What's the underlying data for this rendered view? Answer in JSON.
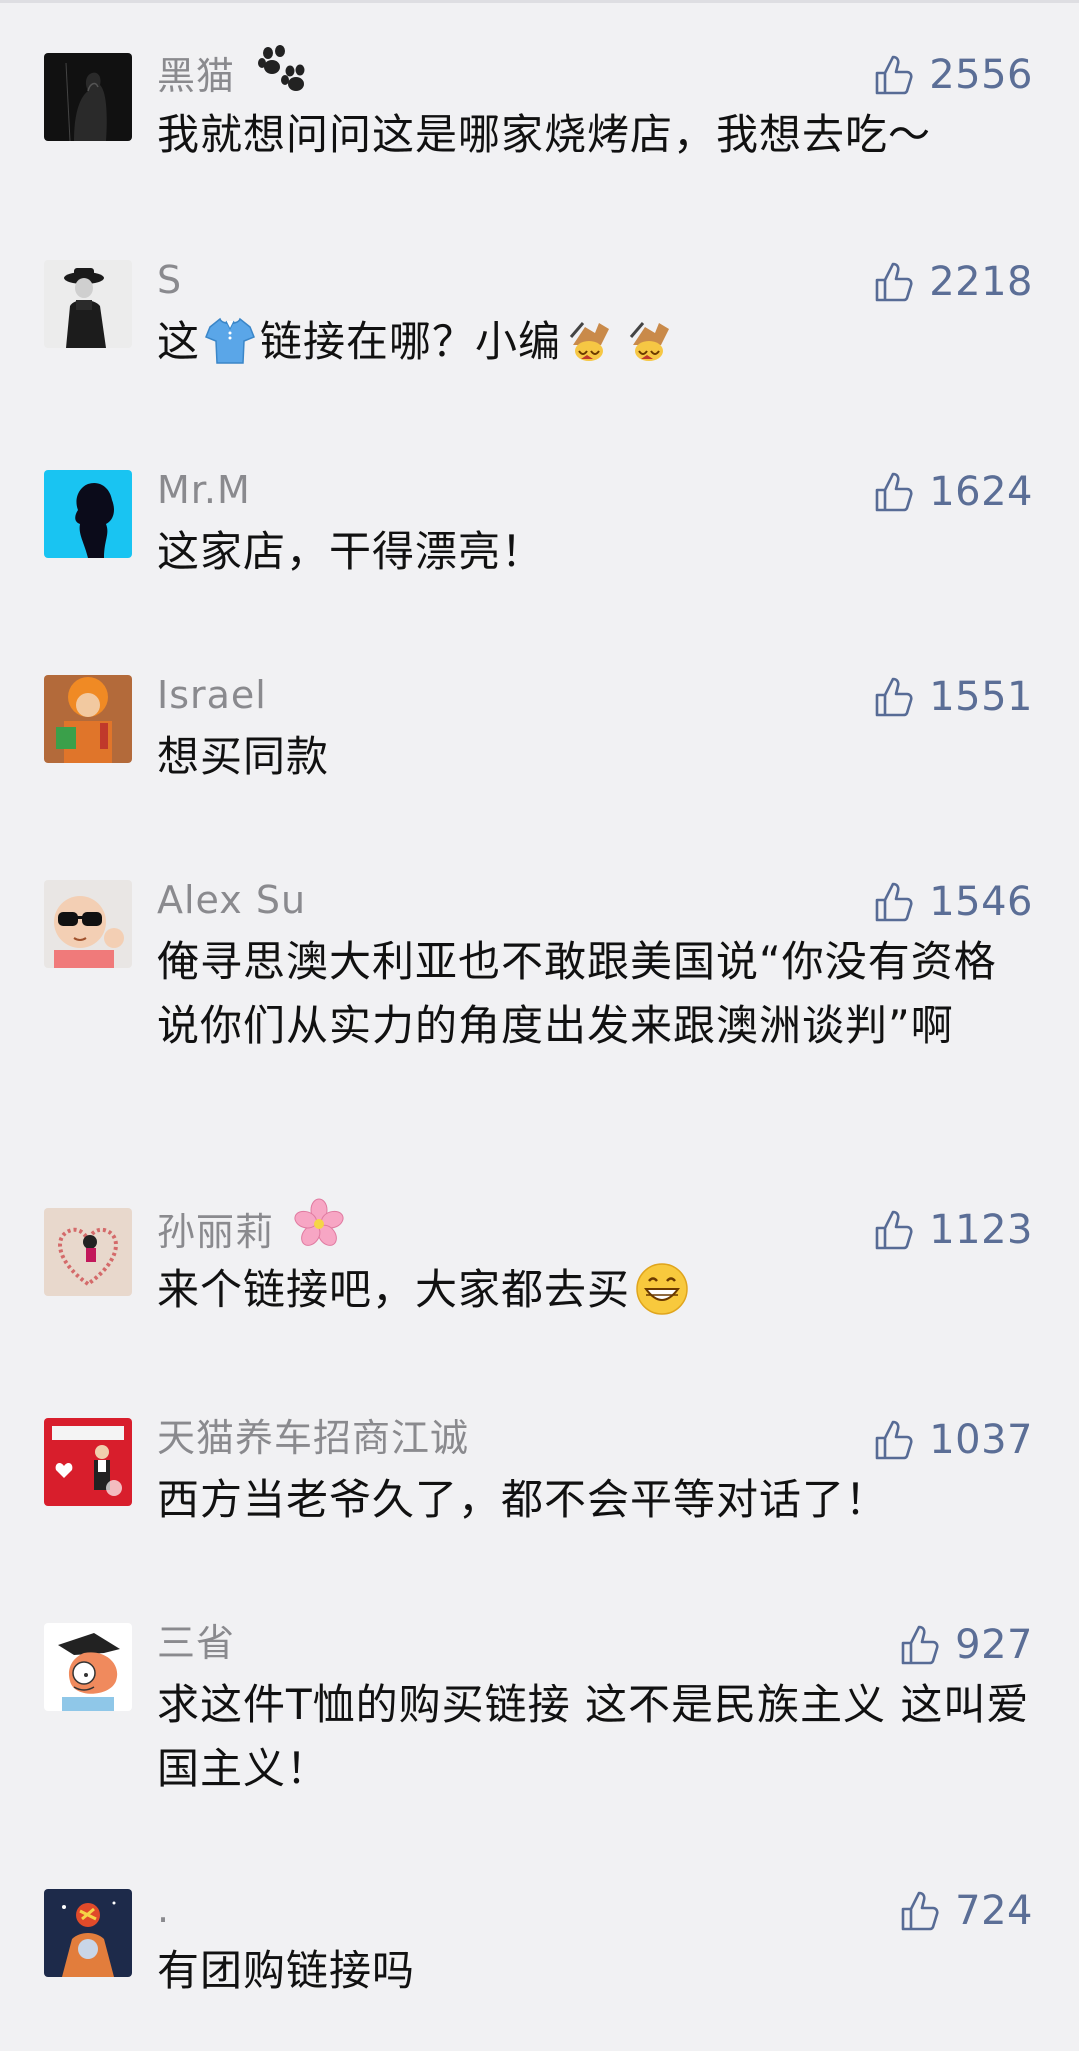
{
  "comments": [
    {
      "username": "黑猫",
      "name_emoji": "paw-prints-icon",
      "likes": "2556",
      "text": "我就想问问这是哪家烧烤店，我想去吃～",
      "avatar_icon": "black-cat-avatar-icon"
    },
    {
      "username": "S",
      "likes": "2218",
      "text_parts": [
        "这",
        "链接在哪？小编"
      ],
      "inline_emojis": [
        "tshirt-icon",
        "applause-icon",
        "applause-icon"
      ],
      "avatar_icon": "man-in-hat-avatar-icon"
    },
    {
      "username": "Mr.M",
      "likes": "1624",
      "text": "这家店，干得漂亮！",
      "avatar_icon": "silhouette-avatar-icon"
    },
    {
      "username": "Israel",
      "likes": "1551",
      "text": "想买同款",
      "avatar_icon": "costume-avatar-icon"
    },
    {
      "username": "Alex Su",
      "likes": "1546",
      "text": "俺寻思澳大利亚也不敢跟美国说“你没有资格说你们从实力的角度出发来跟澳洲谈判”啊",
      "avatar_icon": "kid-sunglasses-avatar-icon"
    },
    {
      "username": "孙丽莉",
      "name_emoji": "cherry-blossom-icon",
      "likes": "1123",
      "text": "来个链接吧，大家都去买",
      "text_emoji": "grinning-face-icon",
      "avatar_icon": "heart-photo-avatar-icon"
    },
    {
      "username": "天猫养车招商江诚",
      "likes": "1037",
      "text": "西方当老爷久了，都不会平等对话了！",
      "avatar_icon": "event-photo-avatar-icon"
    },
    {
      "username": "三省",
      "likes": "927",
      "text": "求这件T恤的购买链接 这不是民族主义 这叫爱国主义！",
      "avatar_icon": "cartoon-avatar-icon"
    },
    {
      "username": ".",
      "likes": "724",
      "text": "有团购链接吗",
      "avatar_icon": "astronaut-avatar-icon"
    }
  ],
  "colors": {
    "background": "#f1f1f3",
    "username": "#8a8a8e",
    "like": "#576b95",
    "text": "#111111"
  }
}
